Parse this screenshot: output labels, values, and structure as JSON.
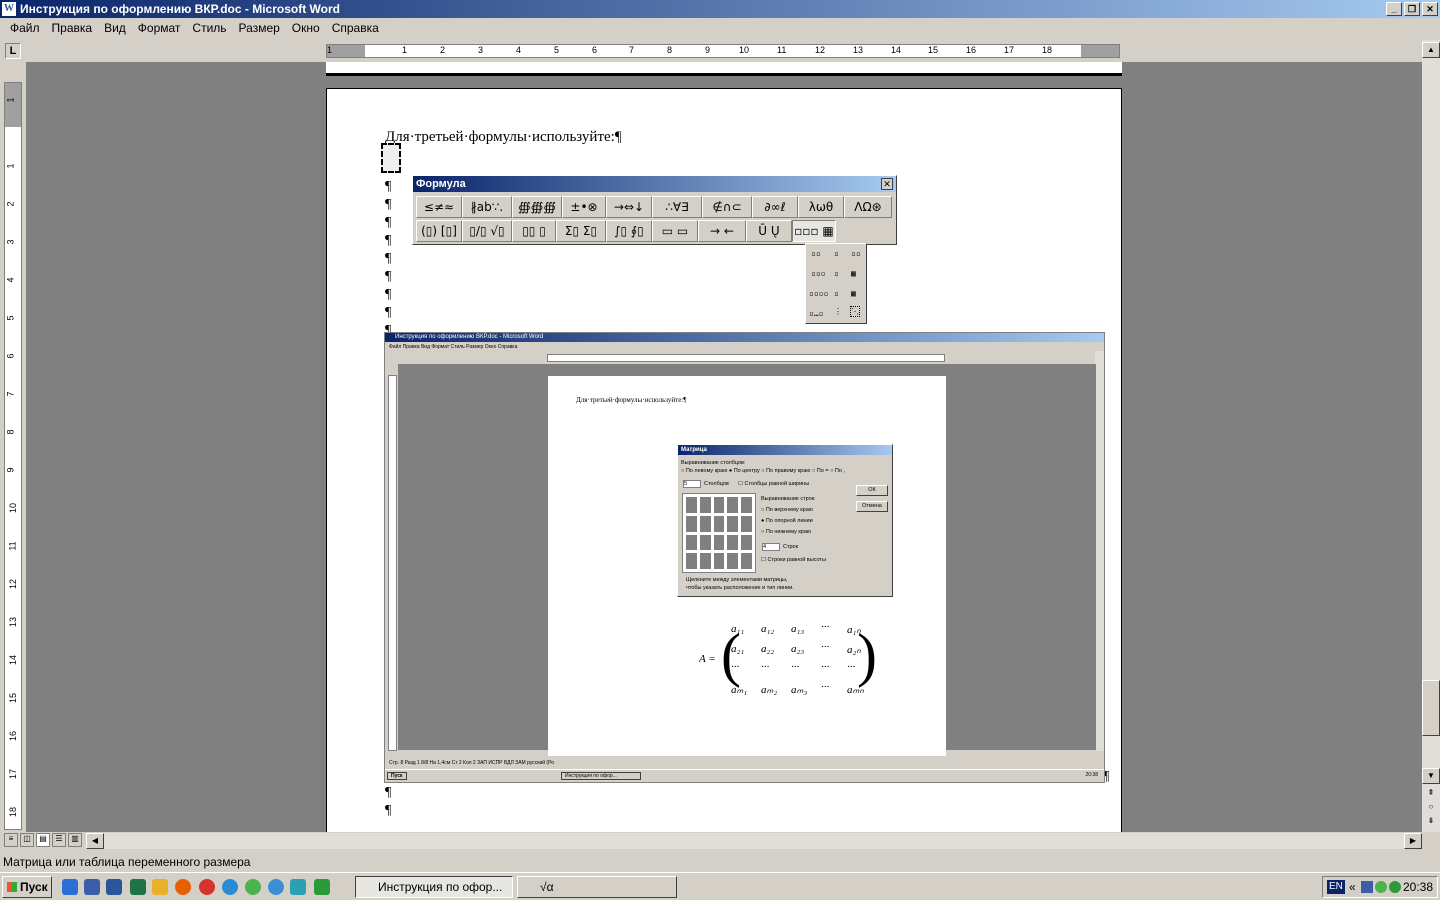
{
  "window": {
    "title": "Инструкция по оформлению ВКР.doc - Microsoft Word",
    "app_icon": "W",
    "controls": [
      "_",
      "❐",
      "✕"
    ]
  },
  "menu": [
    "Файл",
    "Правка",
    "Вид",
    "Формат",
    "Стиль",
    "Размер",
    "Окно",
    "Справка"
  ],
  "ruler": {
    "tab_selector": "L",
    "h_numbers": [
      "1",
      "1",
      "2",
      "3",
      "4",
      "5",
      "6",
      "7",
      "8",
      "9",
      "10",
      "11",
      "12",
      "13",
      "14",
      "15",
      "16",
      "17",
      "18"
    ],
    "v_numbers": [
      "1",
      "1",
      "2",
      "3",
      "4",
      "5",
      "6",
      "7",
      "8",
      "9",
      "10",
      "11",
      "12",
      "13",
      "14",
      "15",
      "16",
      "17",
      "18"
    ]
  },
  "document": {
    "line1": "Для·третьей·формулы·используйте:¶",
    "pilcrow": "¶"
  },
  "formula_toolbar": {
    "title": "Формула",
    "close": "✕",
    "row1": [
      "≤≠≈",
      "∦ab∵.",
      "∰∰∰",
      "±•⊗",
      "→⇔↓",
      "∴∀∃",
      "∉∩⊂",
      "∂∞ℓ",
      "λωθ",
      "ΛΩ⊛"
    ],
    "row2": [
      "(▯) [▯]",
      "▯/▯ √▯",
      "▯▯ ▯",
      "Σ▯ Σ▯",
      "∫▯ ∮▯",
      "▭ ▭",
      "→ ←",
      "Ū Ų",
      "▫▫▫ ▦"
    ]
  },
  "matrix_palette": [
    "▫▫",
    "▫",
    "▫▫",
    "▫▫▫",
    "▫",
    "▦",
    "▫▫▫▫",
    "▫",
    "▦",
    "▫…▫",
    "⋮",
    "⋱"
  ],
  "embedded": {
    "title": "Инструкция по оформлению ВКР.doc - Microsoft Word",
    "menu": "Файл   Правка   Вид   Формат   Стиль   Размер   Окно   Справка",
    "doc_text": "Для·третьей·формулы·используйте:¶",
    "status": "Стр. 8      Разд 1       8/8       На 1,4см    Ст 2     Кол 2                  ЗАП   ИСПР   ВДЛ   ЗАМ   русский (Ро",
    "taskbar": "Пуск",
    "task": "Инструкция по офор...",
    "clock": "20:38",
    "dialog": {
      "title": "Матрица",
      "col_align_label": "Выравнивание столбцов:",
      "col_opts": "○ По левому краю   ● По центру   ○ По правому краю   ○ По =   ○ По ,",
      "cols_value": "5",
      "cols_label": "Столбцов",
      "equal_cols": "☐ Столбцы равной ширины",
      "row_align_label": "Выравнивание строк:",
      "row_opt1": "○ По верхнему краю",
      "row_opt2": "● По опорной линии",
      "row_opt3": "○ По нижнему краю",
      "rows_value": "4",
      "rows_label": "Строк",
      "equal_rows": "☐ Строки равной высоты",
      "hint1": "Щелкните между элементами матрицы,",
      "hint2": "чтобы указать расположение и тип линии.",
      "ok": "ОК",
      "cancel": "Отмена"
    },
    "matrix": {
      "lhs": "A =",
      "rows": [
        [
          "a₁₁",
          "a₁₂",
          "a₁₃",
          "···",
          "a₁ₙ"
        ],
        [
          "a₂₁",
          "a₂₂",
          "a₂₃",
          "···",
          "a₂ₙ"
        ],
        [
          "···",
          "···",
          "···",
          "···",
          "···"
        ],
        [
          "aₘ₁",
          "aₘ₂",
          "aₘ₃",
          "···",
          "aₘₙ"
        ]
      ]
    }
  },
  "statusbar": "Матрица или таблица переменного размера",
  "taskbar": {
    "start": "Пуск",
    "tasks": [
      "Инструкция по офор...",
      "√α"
    ],
    "lang": "EN",
    "clock": "20:38"
  },
  "colors": {
    "titlebar_start": "#0a246a",
    "titlebar_end": "#a6caf0",
    "chrome": "#d4d0c8",
    "doc_bg": "#808080"
  }
}
